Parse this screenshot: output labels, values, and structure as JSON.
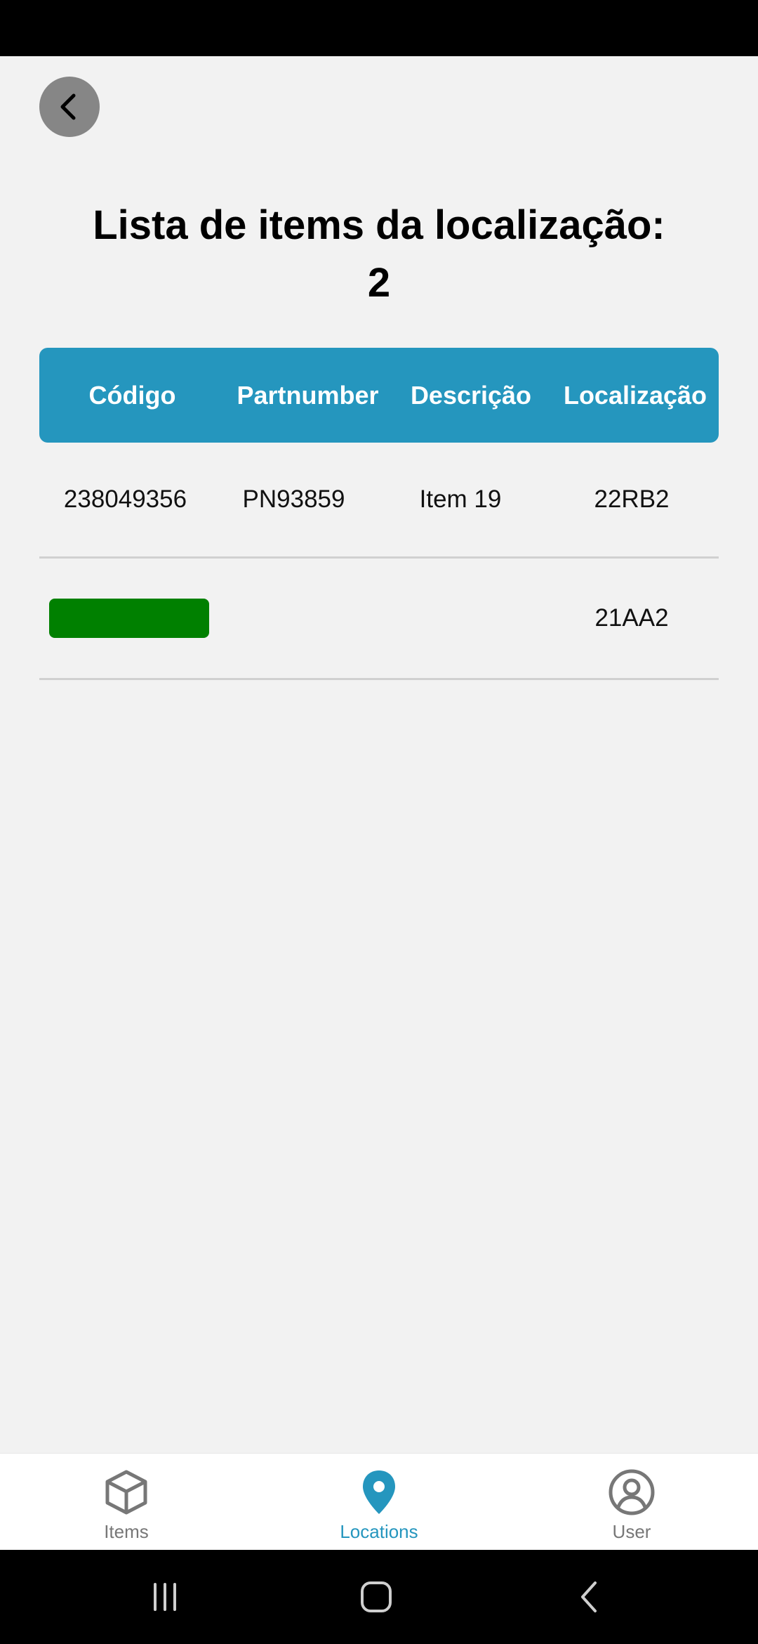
{
  "page": {
    "title_line1": "Lista de items da localização:",
    "title_line2": "2"
  },
  "back_button": {
    "icon": "chevron-left-icon"
  },
  "table": {
    "headers": [
      "Código",
      "Partnumber",
      "Descrição",
      "Localização"
    ],
    "rows": [
      {
        "codigo": "238049356",
        "partnumber": "PN93859",
        "descricao": "Item 19",
        "localizacao": "22RB2"
      },
      {
        "codigo": "",
        "partnumber": "",
        "descricao": "",
        "localizacao": "21AA2"
      }
    ]
  },
  "bottom_nav": {
    "items": [
      {
        "label": "Items",
        "icon": "cube-icon",
        "active": false
      },
      {
        "label": "Locations",
        "icon": "map-pin-icon",
        "active": true
      },
      {
        "label": "User",
        "icon": "user-circle-icon",
        "active": false
      }
    ]
  },
  "colors": {
    "accent": "#2596be",
    "row_marker": "#008000",
    "background": "#f2f2f2"
  }
}
